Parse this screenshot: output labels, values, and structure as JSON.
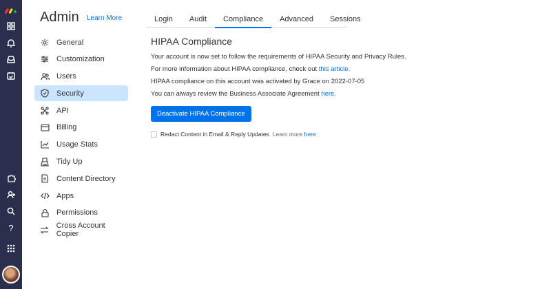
{
  "rail": {
    "icons": [
      "monday-logo-icon",
      "grid-icon",
      "bell-icon",
      "inbox-icon",
      "calendar-check-icon",
      "puzzle-icon",
      "add-user-icon",
      "search-icon",
      "help-icon",
      "apps-grid-icon"
    ],
    "help_glyph": "?"
  },
  "admin": {
    "title": "Admin",
    "learn_more": "Learn More"
  },
  "nav": {
    "items": [
      {
        "label": "General",
        "icon": "gear-icon"
      },
      {
        "label": "Customization",
        "icon": "sliders-icon"
      },
      {
        "label": "Users",
        "icon": "users-icon"
      },
      {
        "label": "Security",
        "icon": "shield-icon",
        "active": true
      },
      {
        "label": "API",
        "icon": "api-icon"
      },
      {
        "label": "Billing",
        "icon": "credit-card-icon"
      },
      {
        "label": "Usage Stats",
        "icon": "chart-icon"
      },
      {
        "label": "Tidy Up",
        "icon": "broom-icon"
      },
      {
        "label": "Content Directory",
        "icon": "directory-icon"
      },
      {
        "label": "Apps",
        "icon": "code-icon"
      },
      {
        "label": "Permissions",
        "icon": "lock-icon"
      },
      {
        "label": "Cross Account Copier",
        "icon": "arrows-icon"
      }
    ]
  },
  "tabs": [
    {
      "label": "Login"
    },
    {
      "label": "Audit"
    },
    {
      "label": "Compliance",
      "active": true
    },
    {
      "label": "Advanced"
    },
    {
      "label": "Sessions"
    }
  ],
  "content": {
    "title": "HIPAA Compliance",
    "line1": "Your account is now set to follow the requirements of HIPAA Security and Privacy Rules.",
    "line2_text": "For more information about HIPAA compliance, check out ",
    "line2_link": "this article.",
    "line3": "HIPAA compliance on this account was activated by Grace on 2022-07-05",
    "line4_text": "You can always review the Business Associate Agreement ",
    "line4_link": "here.",
    "button": "Deactivate HIPAA Compliance",
    "checkbox_label": "Redact Content in Email & Reply Updates",
    "checkbox_hint_text": "Learn more ",
    "checkbox_hint_link": "here"
  },
  "colors": {
    "accent": "#0073ea",
    "rail_bg": "#292f4c",
    "active_nav": "#cce5ff"
  }
}
